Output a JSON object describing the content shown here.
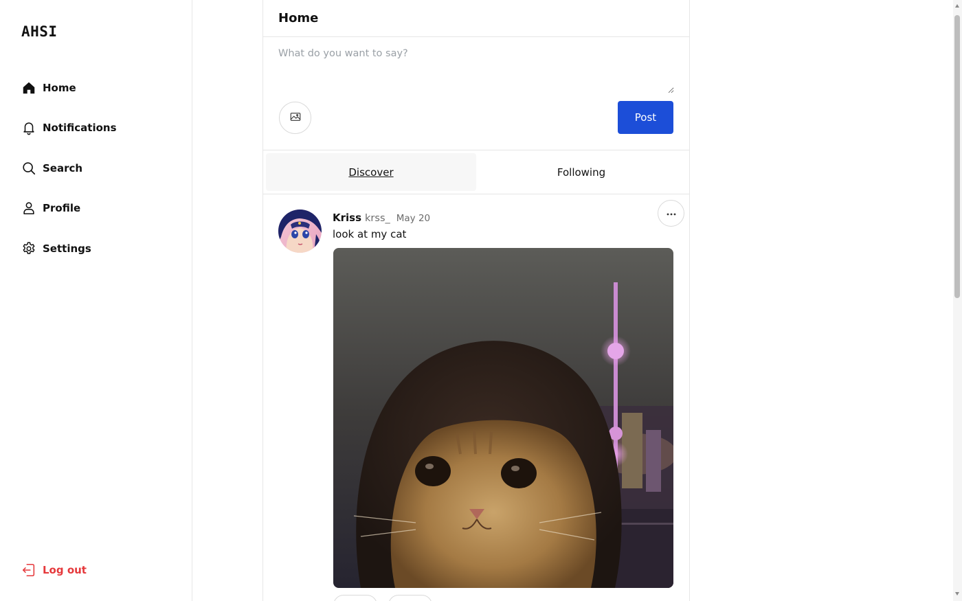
{
  "app": {
    "logo": "AHSI"
  },
  "sidebar": {
    "items": [
      {
        "label": "Home",
        "icon": "home-icon"
      },
      {
        "label": "Notifications",
        "icon": "bell-icon"
      },
      {
        "label": "Search",
        "icon": "search-icon"
      },
      {
        "label": "Profile",
        "icon": "user-icon"
      },
      {
        "label": "Settings",
        "icon": "gear-icon"
      }
    ],
    "logout_label": "Log out",
    "logout_icon": "logout-icon"
  },
  "header": {
    "title": "Home"
  },
  "composer": {
    "placeholder": "What do you want to say?",
    "value": "",
    "image_button_icon": "image-icon",
    "post_label": "Post"
  },
  "tabs": [
    {
      "label": "Discover",
      "active": true
    },
    {
      "label": "Following",
      "active": false
    }
  ],
  "feed": [
    {
      "author_name": "Kriss",
      "handle": "krss_",
      "date": "May 20",
      "text": "look at my cat",
      "more_icon": "more-horizontal-icon"
    }
  ],
  "colors": {
    "accent": "#1c4ed8",
    "logout": "#e5383b",
    "border": "#e6e6e6",
    "muted_text": "#6b6b6b"
  }
}
